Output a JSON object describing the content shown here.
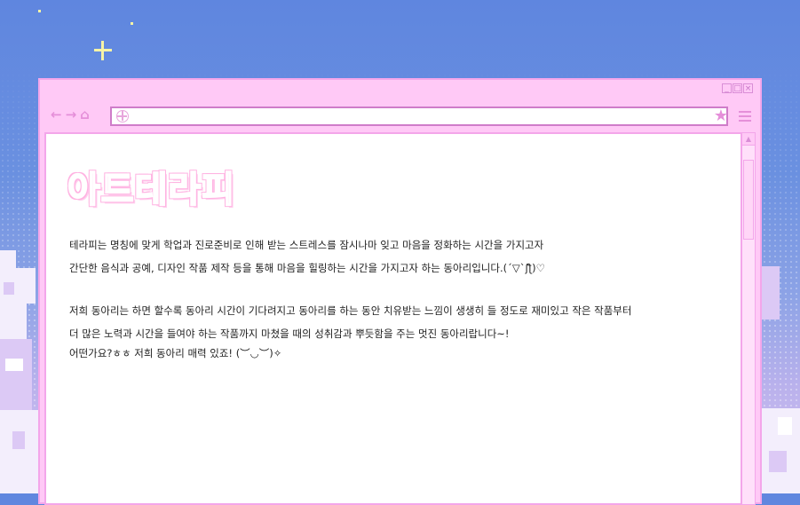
{
  "browser": {
    "url": "",
    "window_controls": [
      "_",
      "□",
      "×"
    ],
    "nav_icons": [
      "back-arrow-icon",
      "forward-arrow-icon",
      "home-icon"
    ],
    "accent_pink": "#ff82c8",
    "frame_pink": "#ffc9f6"
  },
  "page": {
    "title": "아트테라피",
    "intro": [
      "테라피는 명칭에 맞게 학업과 진로준비로 인해 받는 스트레스를 잠시나마 잊고 마음을 정화하는 시간을 가지고자",
      "간단한 음식과 공예, 디자인 작품 제작 등을 통해 마음을 힐링하는 시간을 가지고자 하는 동아리입니다.(´▽`ʃƪ)♡"
    ],
    "body": [
      "저희 동아리는 하면 할수록 동아리 시간이 기다려지고 동아리를 하는 동안 치유받는 느낌이 생생히 들 정도로 재미있고 작은 작품부터",
      "더 많은 노력과 시간을 들여야 하는 작품까지 마쳤을 때의 성취감과 뿌듯함을 주는 멋진 동아리랍니다~!",
      "어떤가요?ㅎㅎ 저희 동아리 매력 있죠! (︶◡︶)✧"
    ]
  }
}
